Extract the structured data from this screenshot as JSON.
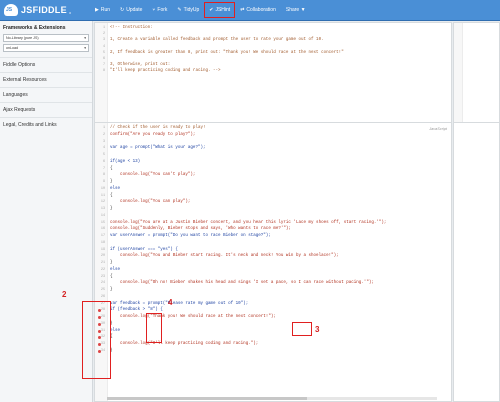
{
  "topbar": {
    "logo_text": "JSFIDDLE",
    "logo_icon_text": "JS",
    "logo_version": "α",
    "nav": [
      {
        "icon": "▶",
        "label": "Run"
      },
      {
        "icon": "↻",
        "label": "Update"
      },
      {
        "icon": "⑂",
        "label": "Fork"
      },
      {
        "icon": "✎",
        "label": "TidyUp"
      },
      {
        "icon": "✔",
        "label": "JSHint"
      },
      {
        "icon": "⇄",
        "label": "Collaboration"
      },
      {
        "icon": "",
        "label": "Share ▼"
      }
    ]
  },
  "sidebar": {
    "heading": "Frameworks & Extensions",
    "selects": [
      {
        "value": "No-Library (pure JS)"
      },
      {
        "value": "onLoad"
      }
    ],
    "items": [
      "Fiddle Options",
      "External Resources",
      "Languages",
      "Ajax Requests",
      "Legal, Credits and Links"
    ]
  },
  "html_panel": {
    "lines": [
      "<!-- Instruction:",
      "",
      "1, Create a variable called feedback and prompt the user to rate your game out of 10.",
      "",
      "2, If feedback is greater than 8, print out: \"Thank you! We should race at the next concert!\"",
      "",
      "3, Otherwise, print out:",
      "\"I'll keep practicing coding and racing. -->"
    ]
  },
  "js_panel": {
    "lang_label": "JavaScript",
    "lines": [
      "// Check if the user is ready to play!",
      "confirm(\"Are you ready to play?\");",
      "",
      "var age = prompt(\"What is your age?\");",
      "",
      "if(age < 13)",
      "{",
      "    console.log(\"You can't play\");",
      "}",
      "else",
      "{",
      "    console.log(\"You can play\");",
      "}",
      "",
      "console.log(\"You are at a Justin Bieber concert, and you hear this lyric 'Lace my shoes off, start racing.'\");",
      "console.log(\"Suddenly, Bieber stops and says, 'Who wants to race me?'\");",
      "var userAnswer = prompt(\"Do you want to race Bieber on stage?\");",
      "",
      "if (userAnswer === \"yes\") {",
      "    console.log(\"You and Bieber start racing. It's neck and neck! You win by a shoelace!\");",
      "}",
      "else",
      "{",
      "    console.log(\"Oh no! Bieber shakes his head and sings 'I set a pace, so I can race without pacing.'\");",
      "}",
      "",
      "var feedback = prompt(\"Please rate my game out of 10\");",
      "if (feedback > \"8\") {",
      "    console.log(\"Thank you! We should race at the next concert!\");",
      "}",
      "else",
      "{",
      "    console.log(\"I'll keep practicing coding and racing.\");",
      "}"
    ]
  },
  "annotations": {
    "one": "1",
    "two": "2",
    "three": "3",
    "four": "4"
  },
  "colors": {
    "topbar": "#4a8fd6",
    "annotation": "#e02020"
  }
}
